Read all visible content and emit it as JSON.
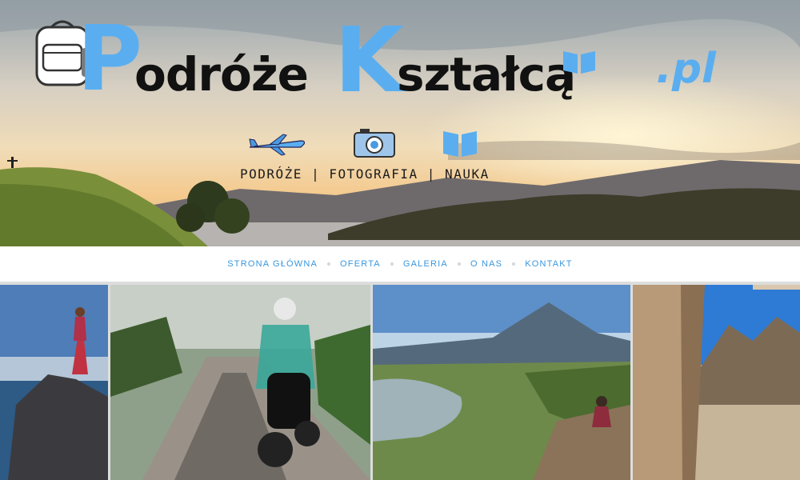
{
  "brand": {
    "part1_initial": "P",
    "part1_rest": "odróże",
    "part2_initial": "K",
    "part2_rest": "ształcą",
    "tld": ".pl"
  },
  "tagline": "PODRÓŻE | FOTOGRAFIA | NAUKA",
  "icons": {
    "brand": [
      "backpack-icon",
      "book-icon"
    ],
    "tagline": [
      "plane-icon",
      "camera-icon",
      "book-icon"
    ]
  },
  "nav": {
    "items": [
      {
        "label": "STRONA GŁÓWNA"
      },
      {
        "label": "OFERTA"
      },
      {
        "label": "GALERIA"
      },
      {
        "label": "O NAS"
      },
      {
        "label": "KONTAKT"
      }
    ]
  },
  "colors": {
    "accent": "#3a97dd",
    "logo_blue": "#5aaef0",
    "logo_dark": "#111111"
  }
}
